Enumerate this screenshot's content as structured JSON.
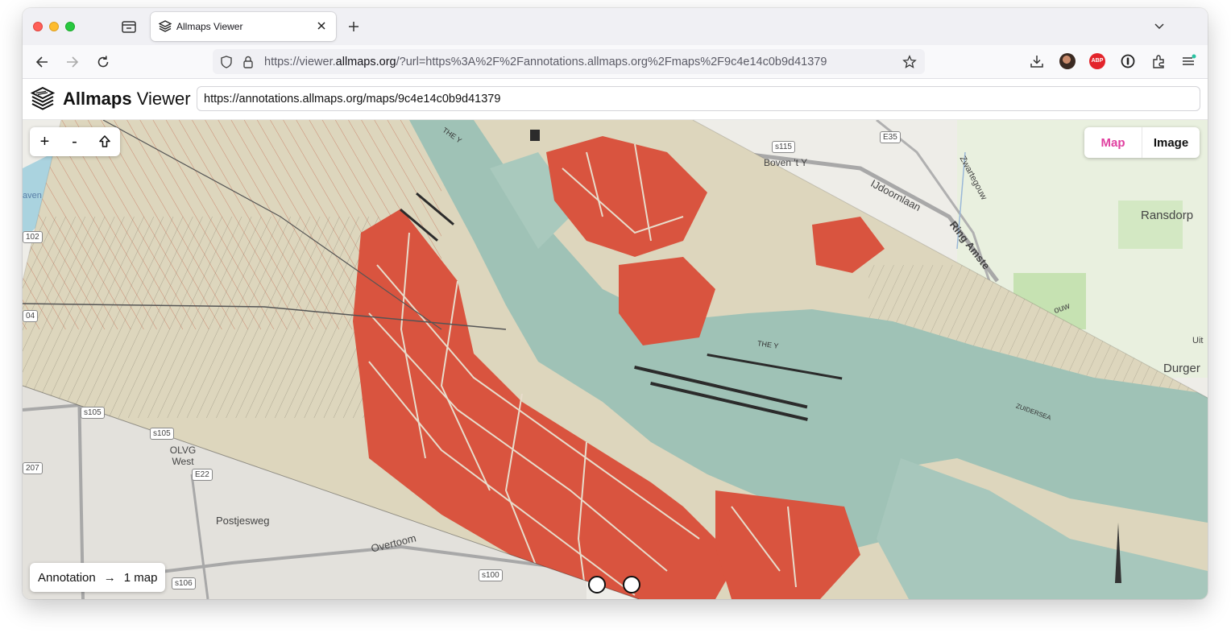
{
  "browser": {
    "tab": {
      "title": "Allmaps Viewer",
      "favicon": "allmaps-logo-icon"
    },
    "url": {
      "prefix": "https://viewer.",
      "domain": "allmaps.org",
      "rest": "/?url=https%3A%2F%2Fannotations.allmaps.org%2Fmaps%2F9c4e14c0b9d41379"
    },
    "toolbar_icons": [
      "downloads-icon",
      "account-avatar",
      "adblock-icon",
      "password-manager-icon",
      "extensions-icon",
      "menu-icon"
    ],
    "adblock_label": "ABP"
  },
  "app": {
    "brand_bold": "Allmaps",
    "brand_light": " Viewer",
    "annotation_url": "https://annotations.allmaps.org/maps/9c4e14c0b9d41379"
  },
  "map_controls": {
    "zoom_in": "+",
    "zoom_out": "-",
    "view_toggle": {
      "map": "Map",
      "image": "Image",
      "active": "map"
    }
  },
  "status": {
    "source": "Annotation",
    "arrow": "→",
    "count": "1 map"
  },
  "map_labels": {
    "places": [
      "Boven 't Y",
      "Ransdorp",
      "Durger",
      "OLVG West",
      "Postjesweg",
      "Overtoom",
      "IJdoornlaan",
      "Zwartegouw",
      "Ring Amste",
      "ouw",
      "Uit",
      "aven"
    ],
    "shields": [
      "E35",
      "s115",
      "s105",
      "s105",
      "E22",
      "s100",
      "s106",
      "102",
      "04",
      "207"
    ],
    "historic": [
      "THE Y",
      "THE Y",
      "ZUIDERSEA"
    ]
  },
  "colors": {
    "accent": "#e040a0",
    "block_red": "#d9543f",
    "water_green": "#9fc2b6",
    "paper": "#ddd6bd"
  }
}
